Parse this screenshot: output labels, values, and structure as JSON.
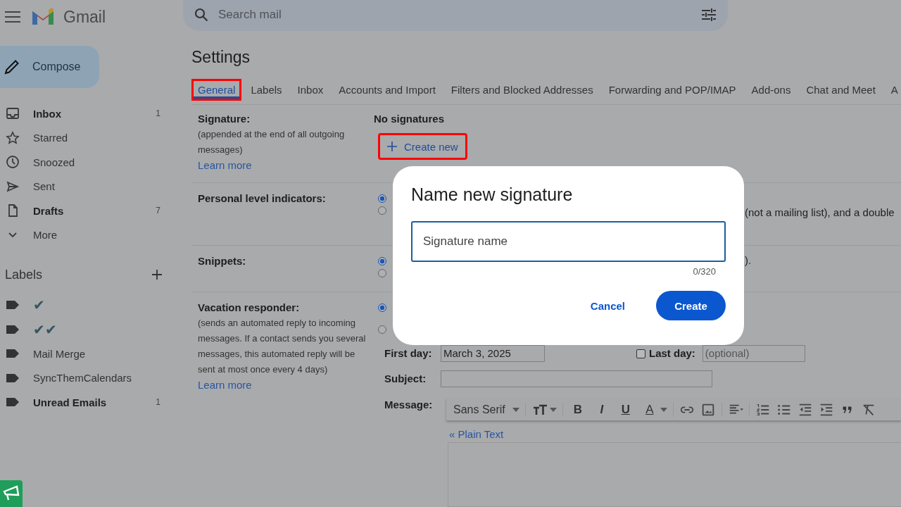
{
  "app": {
    "name": "Gmail"
  },
  "search": {
    "placeholder": "Search mail"
  },
  "compose": {
    "label": "Compose"
  },
  "nav": [
    {
      "label": "Inbox",
      "count": "1",
      "bold": true
    },
    {
      "label": "Starred",
      "bold": false
    },
    {
      "label": "Snoozed",
      "bold": false
    },
    {
      "label": "Sent",
      "bold": false
    },
    {
      "label": "Drafts",
      "count": "7",
      "bold": true
    },
    {
      "label": "More",
      "bold": false
    }
  ],
  "labels": {
    "title": "Labels",
    "items": [
      {
        "label": "✔",
        "bold": false,
        "kind": "mark"
      },
      {
        "label": "✔✔",
        "bold": false,
        "kind": "mark"
      },
      {
        "label": "Mail Merge",
        "bold": false,
        "kind": "name"
      },
      {
        "label": "SyncThemCalendars",
        "bold": false,
        "kind": "name"
      },
      {
        "label": "Unread Emails",
        "count": "1",
        "bold": true,
        "kind": "name"
      }
    ]
  },
  "settings": {
    "title": "Settings",
    "tabs": [
      {
        "label": "General",
        "selected": true,
        "highlighted": true
      },
      {
        "label": "Labels",
        "selected": false,
        "highlighted": false
      },
      {
        "label": "Inbox",
        "selected": false,
        "highlighted": false
      },
      {
        "label": "Accounts and Import",
        "selected": false,
        "highlighted": false
      },
      {
        "label": "Filters and Blocked Addresses",
        "selected": false,
        "highlighted": false
      },
      {
        "label": "Forwarding and POP/IMAP",
        "selected": false,
        "highlighted": false
      },
      {
        "label": "Add-ons",
        "selected": false,
        "highlighted": false
      },
      {
        "label": "Chat and Meet",
        "selected": false,
        "highlighted": false
      },
      {
        "label": "A",
        "selected": false,
        "highlighted": false
      }
    ],
    "signature": {
      "label": "Signature:",
      "description": "(appended at the end of all outgoing messages)",
      "link": "Learn more",
      "status": "No signatures",
      "button": {
        "label": "Create new",
        "highlighted": true
      }
    },
    "personal_level": {
      "label": "Personal level indicators:",
      "options": [
        {
          "selected": true
        },
        {
          "selected": false
        }
      ],
      "visible_text": "(not a mailing list), and a double"
    },
    "snippets": {
      "label": "Snippets:",
      "options": [
        {
          "selected": true
        },
        {
          "selected": false
        }
      ],
      "visible_text": ")."
    },
    "vacation": {
      "label": "Vacation responder:",
      "description": "(sends an automated reply to incoming messages. If a contact sends you several messages, this automated reply will be sent at most once every 4 days)",
      "link": "Learn more",
      "options": [
        {
          "selected": true
        },
        {
          "selected": false
        }
      ],
      "first_day": {
        "label": "First day:",
        "value": "March 3, 2025"
      },
      "last_day": {
        "label": "Last day:",
        "checked": false,
        "placeholder": "(optional)"
      },
      "subject": {
        "label": "Subject:"
      },
      "message": {
        "label": "Message:",
        "font": "Sans Serif",
        "letter_buttons": [
          "B",
          "I",
          "U",
          "A"
        ],
        "plain_text_link": "« Plain Text"
      }
    }
  },
  "dialog": {
    "title": "Name new signature",
    "input": {
      "placeholder": "Signature name"
    },
    "counter": "0/320",
    "buttons": [
      {
        "label": "Cancel",
        "kind": "text"
      },
      {
        "label": "Create",
        "kind": "filled"
      }
    ]
  }
}
